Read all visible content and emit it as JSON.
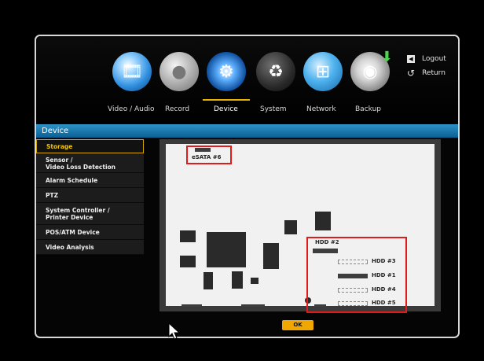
{
  "top_menu": {
    "items": [
      {
        "label": "Video / Audio",
        "icon": "film-reel-icon",
        "active": false
      },
      {
        "label": "Record",
        "icon": "record-disc-icon",
        "active": false
      },
      {
        "label": "Device",
        "icon": "device-gear-icon",
        "active": true
      },
      {
        "label": "System",
        "icon": "system-icon",
        "active": false
      },
      {
        "label": "Network",
        "icon": "network-icon",
        "active": false
      },
      {
        "label": "Backup",
        "icon": "backup-disc-icon",
        "active": false
      }
    ],
    "logout_label": "Logout",
    "return_label": "Return"
  },
  "section_title": "Device",
  "sidebar": {
    "items": [
      {
        "label": "Storage",
        "selected": true
      },
      {
        "label_line1": "Sensor /",
        "label_line2": "Video Loss Detection"
      },
      {
        "label": "Alarm Schedule"
      },
      {
        "label": "PTZ"
      },
      {
        "label_line1": "System Controller /",
        "label_line2": "Printer Device"
      },
      {
        "label": "POS/ATM Device"
      },
      {
        "label": "Video Analysis"
      }
    ]
  },
  "board": {
    "esata_label": "eSATA #6",
    "hdd_labels": {
      "hdd2": "HDD #2",
      "hdd3": "HDD #3",
      "hdd1": "HDD #1",
      "hdd4": "HDD #4",
      "hdd5": "HDD #5"
    }
  },
  "ok_label": "OK",
  "colors": {
    "accent": "#e9b100",
    "header_blue": "#1a7ab4",
    "highlight_red": "#e11a1a"
  }
}
